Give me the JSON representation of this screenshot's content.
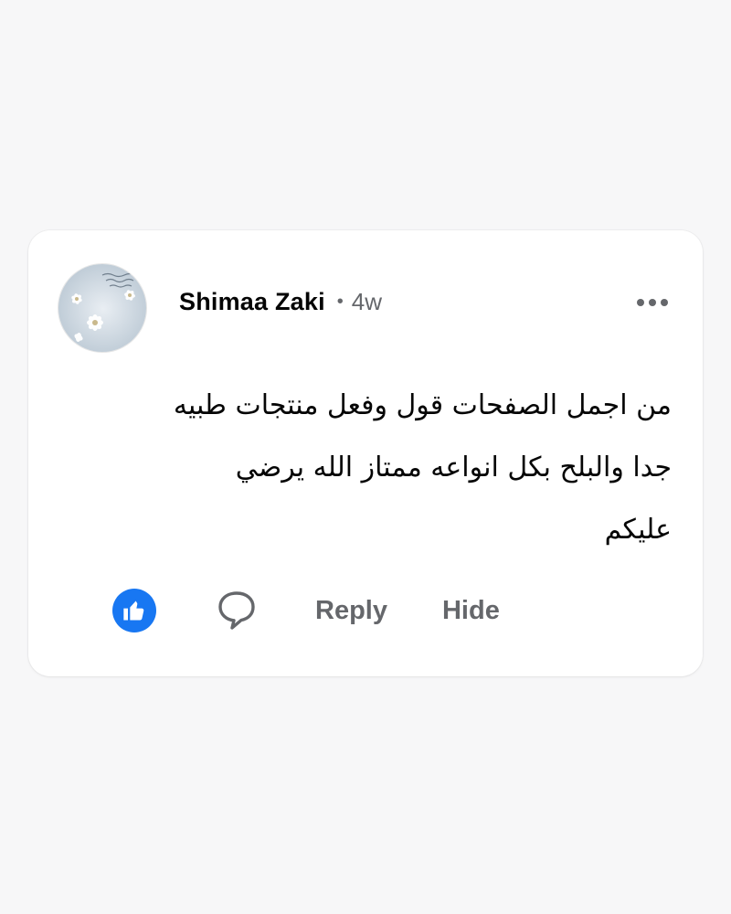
{
  "comment": {
    "author": "Shimaa Zaki",
    "separator": "•",
    "time_ago": "4w",
    "lines": [
      "من اجمل الصفحات قول وفعل منتجات طبيه",
      "جدا والبلح بكل انواعه ممتاز الله يرضي",
      "عليكم"
    ],
    "actions": {
      "reply_label": "Reply",
      "hide_label": "Hide"
    },
    "icons": {
      "like": "thumbs-up-icon",
      "comment": "speech-bubble-icon",
      "more": "more-dots-icon"
    },
    "colors": {
      "accent": "#1877f2",
      "muted": "#65676b",
      "text": "#050505"
    }
  }
}
